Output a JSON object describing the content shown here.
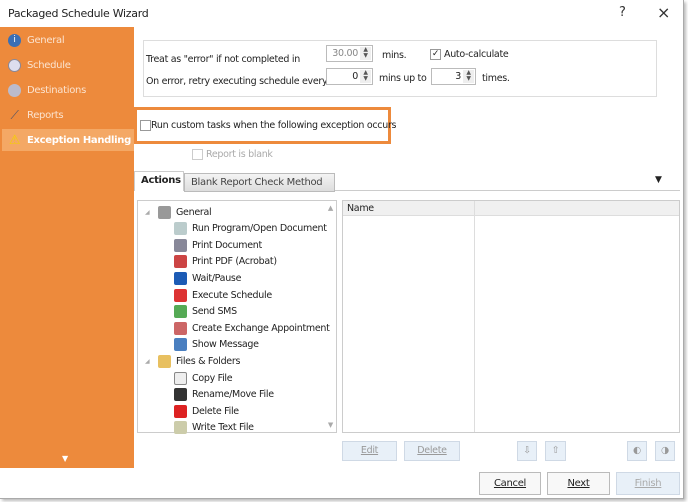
{
  "window": {
    "title": "Packaged Schedule Wizard",
    "help": "?",
    "close": "×"
  },
  "sidebar": {
    "items": [
      {
        "label": "General",
        "icon": "info-icon",
        "color": "#3a6fb5"
      },
      {
        "label": "Schedule",
        "icon": "clock-icon",
        "color": "#667"
      },
      {
        "label": "Destinations",
        "icon": "destinations-icon",
        "color": "#778"
      },
      {
        "label": "Reports",
        "icon": "reports-icon",
        "color": "#889"
      },
      {
        "label": "Exception Handling",
        "icon": "warning-icon",
        "color": "#f5c400",
        "selected": true
      }
    ],
    "scroll_down": "▼",
    "accent": "#ED8A3C"
  },
  "settings": {
    "error_label": "Treat as \"error\" if not completed in",
    "error_minutes": "30.00",
    "mins": "mins.",
    "auto_calculate": "Auto-calculate",
    "auto_calculate_checked": true,
    "retry_label": "On error, retry  executing schedule every",
    "retry_minutes": "0",
    "mins_up_to": "mins up to",
    "retry_times": "3",
    "times": "times."
  },
  "custom_tasks": {
    "label": "Run custom tasks when the following exception occurs",
    "checked": false
  },
  "report_blank": {
    "label": "Report is blank",
    "checked": false,
    "disabled": true
  },
  "tabs": [
    {
      "label": "Actions",
      "active": true
    },
    {
      "label": "Blank Report Check Method"
    }
  ],
  "tree": [
    {
      "label": "General",
      "group": true,
      "icon": "gear-icon"
    },
    {
      "label": "Run Program/Open Document",
      "icon": "run-program-icon"
    },
    {
      "label": "Print Document",
      "icon": "printer-icon"
    },
    {
      "label": "Print PDF (Acrobat)",
      "icon": "print-pdf-icon"
    },
    {
      "label": "Wait/Pause",
      "icon": "pause-icon"
    },
    {
      "label": "Execute Schedule",
      "icon": "execute-schedule-icon"
    },
    {
      "label": "Send SMS",
      "icon": "sms-icon"
    },
    {
      "label": "Create Exchange Appointment",
      "icon": "appointment-icon"
    },
    {
      "label": "Show Message",
      "icon": "info-icon"
    },
    {
      "label": "Files & Folders",
      "group": true,
      "icon": "folder-icon"
    },
    {
      "label": "Copy File",
      "icon": "copy-file-icon"
    },
    {
      "label": "Rename/Move File",
      "icon": "rename-file-icon"
    },
    {
      "label": "Delete File",
      "icon": "delete-icon"
    },
    {
      "label": "Write Text File",
      "icon": "write-file-icon"
    }
  ],
  "list": {
    "columns": [
      "Name",
      ""
    ]
  },
  "actions": {
    "edit": "Edit",
    "delete": "Delete"
  },
  "footer": {
    "cancel": "Cancel",
    "next": "Next",
    "finish": "Finish"
  }
}
